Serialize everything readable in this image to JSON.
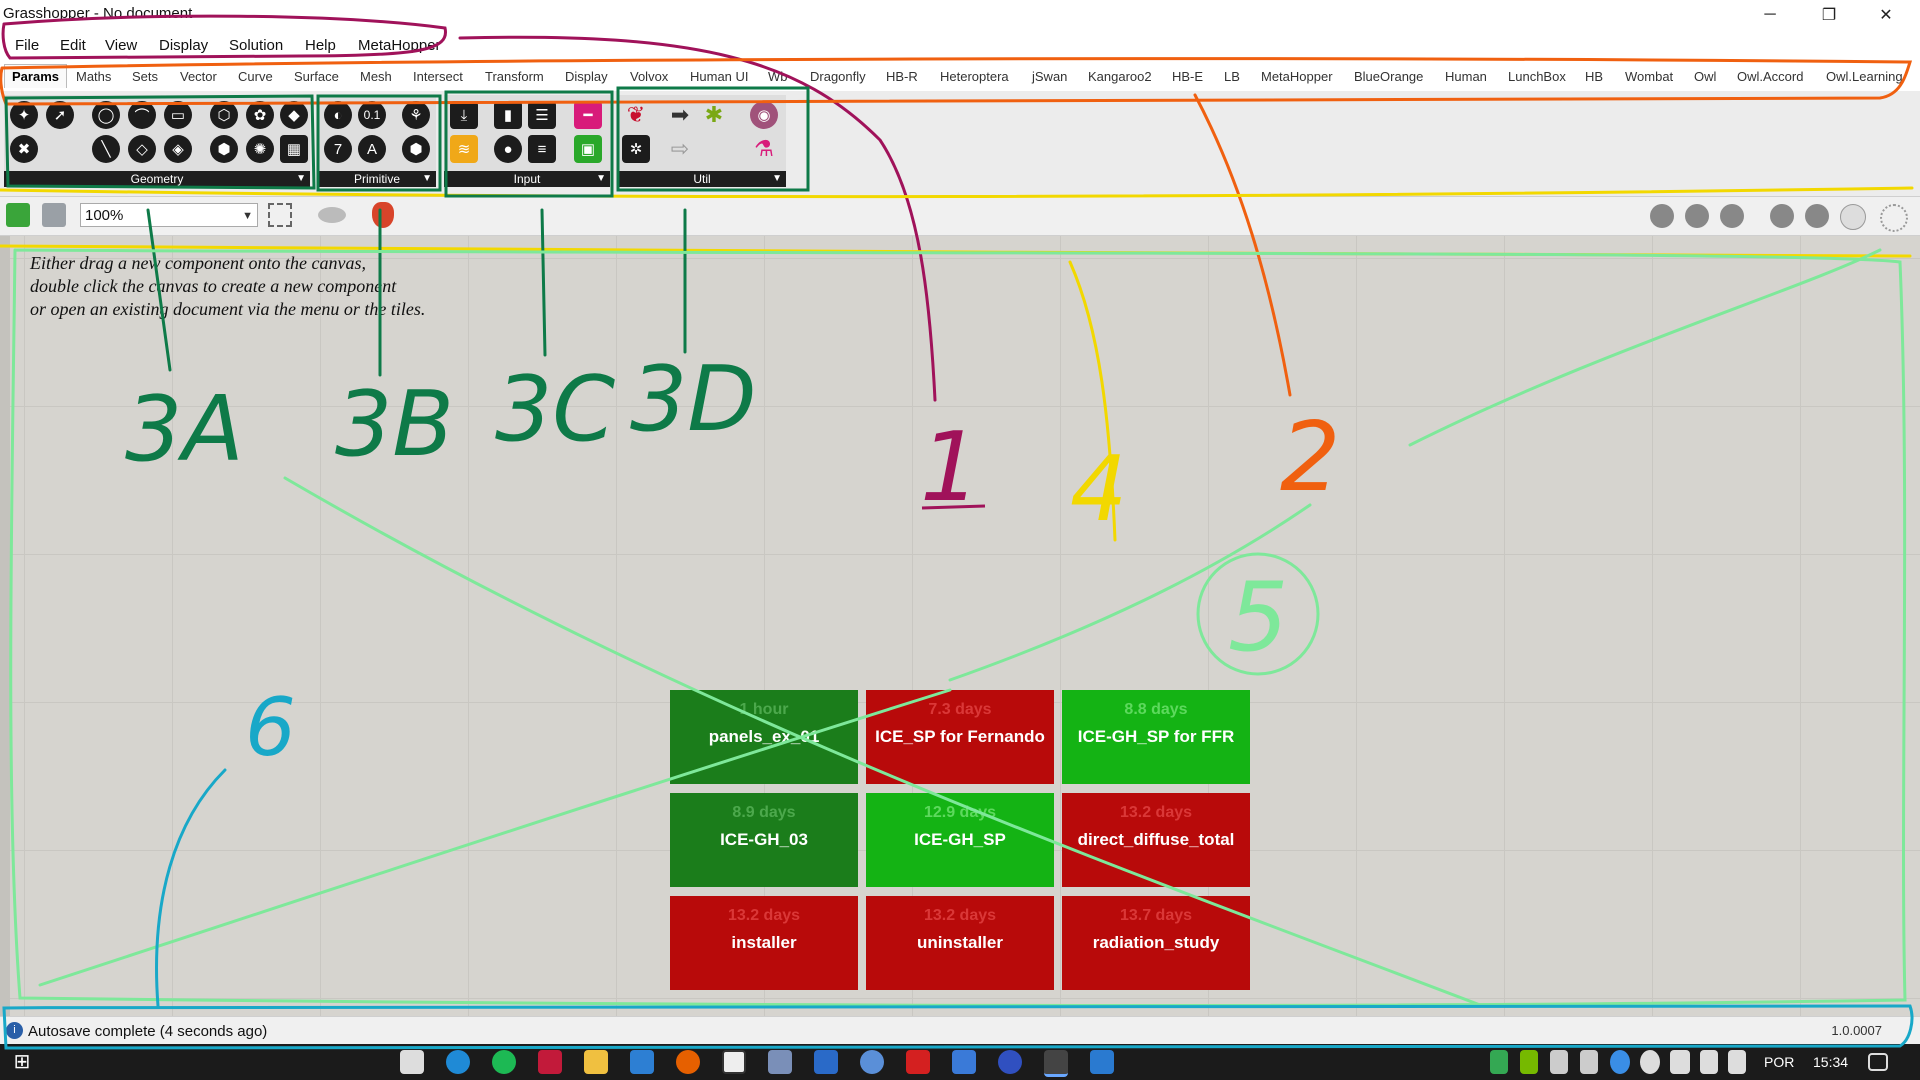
{
  "window": {
    "title": "Grasshopper - No document",
    "minimize": "─",
    "restore": "❐",
    "close": "✕"
  },
  "menu": [
    "File",
    "Edit",
    "View",
    "Display",
    "Solution",
    "Help",
    "MetaHopper"
  ],
  "tabs": [
    "Params",
    "Maths",
    "Sets",
    "Vector",
    "Curve",
    "Surface",
    "Mesh",
    "Intersect",
    "Transform",
    "Display",
    "Volvox",
    "Human UI",
    "Wb",
    "Dragonfly",
    "HB-R",
    "Heteroptera",
    "jSwan",
    "Kangaroo2",
    "HB-E",
    "LB",
    "MetaHopper",
    "BlueOrange",
    "Human",
    "LunchBox",
    "HB",
    "Wombat",
    "Owl",
    "Owl.Accord",
    "Owl.Learning"
  ],
  "active_tab": "Params",
  "panels": {
    "geometry": "Geometry",
    "primitive": "Primitive",
    "input": "Input",
    "util": "Util"
  },
  "toolbar": {
    "zoom": "100%"
  },
  "canvas": {
    "hint": [
      "Either drag a new component onto the canvas,",
      "double click the canvas to create a new component",
      "or open an existing document via the menu or the tiles."
    ]
  },
  "tiles": [
    {
      "age": "1 hour",
      "name": "panels_ex_01",
      "color": "dg"
    },
    {
      "age": "7.3 days",
      "name": "ICE_SP for Fernando",
      "color": "red"
    },
    {
      "age": "8.8 days",
      "name": "ICE-GH_SP for FFR",
      "color": "lg"
    },
    {
      "age": "8.9 days",
      "name": "ICE-GH_03",
      "color": "dg"
    },
    {
      "age": "12.9 days",
      "name": "ICE-GH_SP",
      "color": "lg"
    },
    {
      "age": "13.2 days",
      "name": "direct_diffuse_total",
      "color": "red"
    },
    {
      "age": "13.2 days",
      "name": "installer",
      "color": "red"
    },
    {
      "age": "13.2 days",
      "name": "uninstaller",
      "color": "red"
    },
    {
      "age": "13.7 days",
      "name": "radiation_study",
      "color": "red"
    }
  ],
  "status": {
    "message": "Autosave complete (4 seconds ago)",
    "version": "1.0.0007",
    "icon": "info-icon"
  },
  "taskbar": {
    "language": "POR",
    "time": "15:34"
  },
  "annotations": {
    "a1": "1",
    "a2": "2",
    "a3a": "3A",
    "a3b": "3B",
    "a3c": "3C",
    "a3d": "3D",
    "a4": "4",
    "a5": "5",
    "a6": "6"
  },
  "colors": {
    "annotation_red": "#a0125a",
    "annotation_orange": "#f06010",
    "annotation_yellow": "#f2d800",
    "annotation_green": "#0e7a48",
    "annotation_light_green": "#7ee89a",
    "annotation_blue": "#18a8c8"
  }
}
